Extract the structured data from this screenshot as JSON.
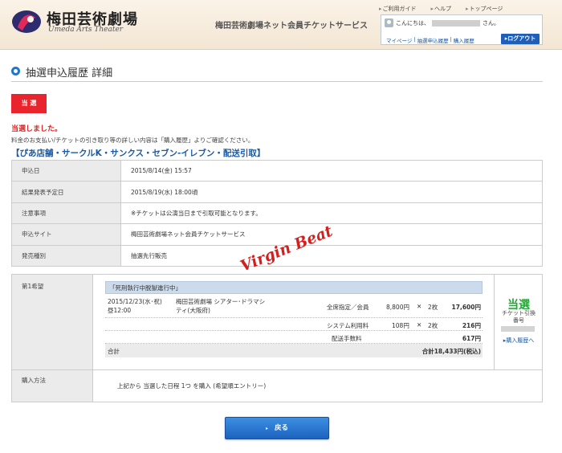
{
  "header": {
    "logo_text": "梅田芸術劇場",
    "logo_sub": "Umeda Arts Theater",
    "service_title": "梅田芸術劇場ネット会員チケットサービス",
    "top_links": [
      "ご利用ガイド",
      "ヘルプ",
      "トップページ"
    ],
    "greeting_prefix": "こんにちは、",
    "greeting_suffix": "さん。",
    "user_links": [
      "マイページ",
      "抽選申込履歴",
      "購入履歴"
    ],
    "logout_label": "▸ログアウト"
  },
  "page": {
    "title": "抽選申込履歴 詳細",
    "badge": "当 選",
    "win_message": "当選しました。",
    "note": "料金のお支払い/チケットの引き取り等の詳しい内容は「購入履歴」よりご確認ください。",
    "pickup": "【ぴあ店舗・サークルK・サンクス・セブン-イレブン・配送引取】"
  },
  "info_rows": [
    {
      "label": "申込日",
      "value": "2015/8/14(金) 15:57"
    },
    {
      "label": "結果発表予定日",
      "value": "2015/8/19(水) 18:00頃"
    },
    {
      "label": "注意事項",
      "value": "※チケットは公演当日まで引取可能となります。"
    },
    {
      "label": "申込サイト",
      "value": "梅田芸術劇場ネット会員チケットサービス"
    },
    {
      "label": "発売種別",
      "value": "抽選先行販売"
    }
  ],
  "signature_text": "Virgin Beat",
  "wish": {
    "label": "第1希望",
    "performance": "「死刑執行中脱獄進行中」",
    "date_line1": "2015/12/23(水･祝)",
    "date_line2": "昼12:00",
    "venue_line1": "梅田芸術劇場 シアター･ドラマシ",
    "venue_line2": "ティ(大阪府)",
    "items": [
      {
        "name": "全席指定／会員",
        "unit_price": "8,800円",
        "times": "✕",
        "qty": "2枚",
        "amount": "17,600円"
      },
      {
        "name": "システム利用料",
        "unit_price": "108円",
        "times": "✕",
        "qty": "2枚",
        "amount": "216円"
      },
      {
        "name": "配送手数料",
        "amount": "617円"
      }
    ],
    "total_label": "合計",
    "total_value": "合計18,433円(税込)",
    "status": "当選",
    "ticket_label_1": "チケット引換",
    "ticket_label_2": "番号",
    "history_link": "▸購入履歴へ"
  },
  "method": {
    "label": "購入方法",
    "value": "上記から 当選した日程 1つ を購入 (希望順エントリー)"
  },
  "back_button": "戻る",
  "colors": {
    "accent_red": "#e8242c",
    "link_blue": "#1a5aa6",
    "won_green": "#2aa43a",
    "button_blue": "#1d62be"
  }
}
